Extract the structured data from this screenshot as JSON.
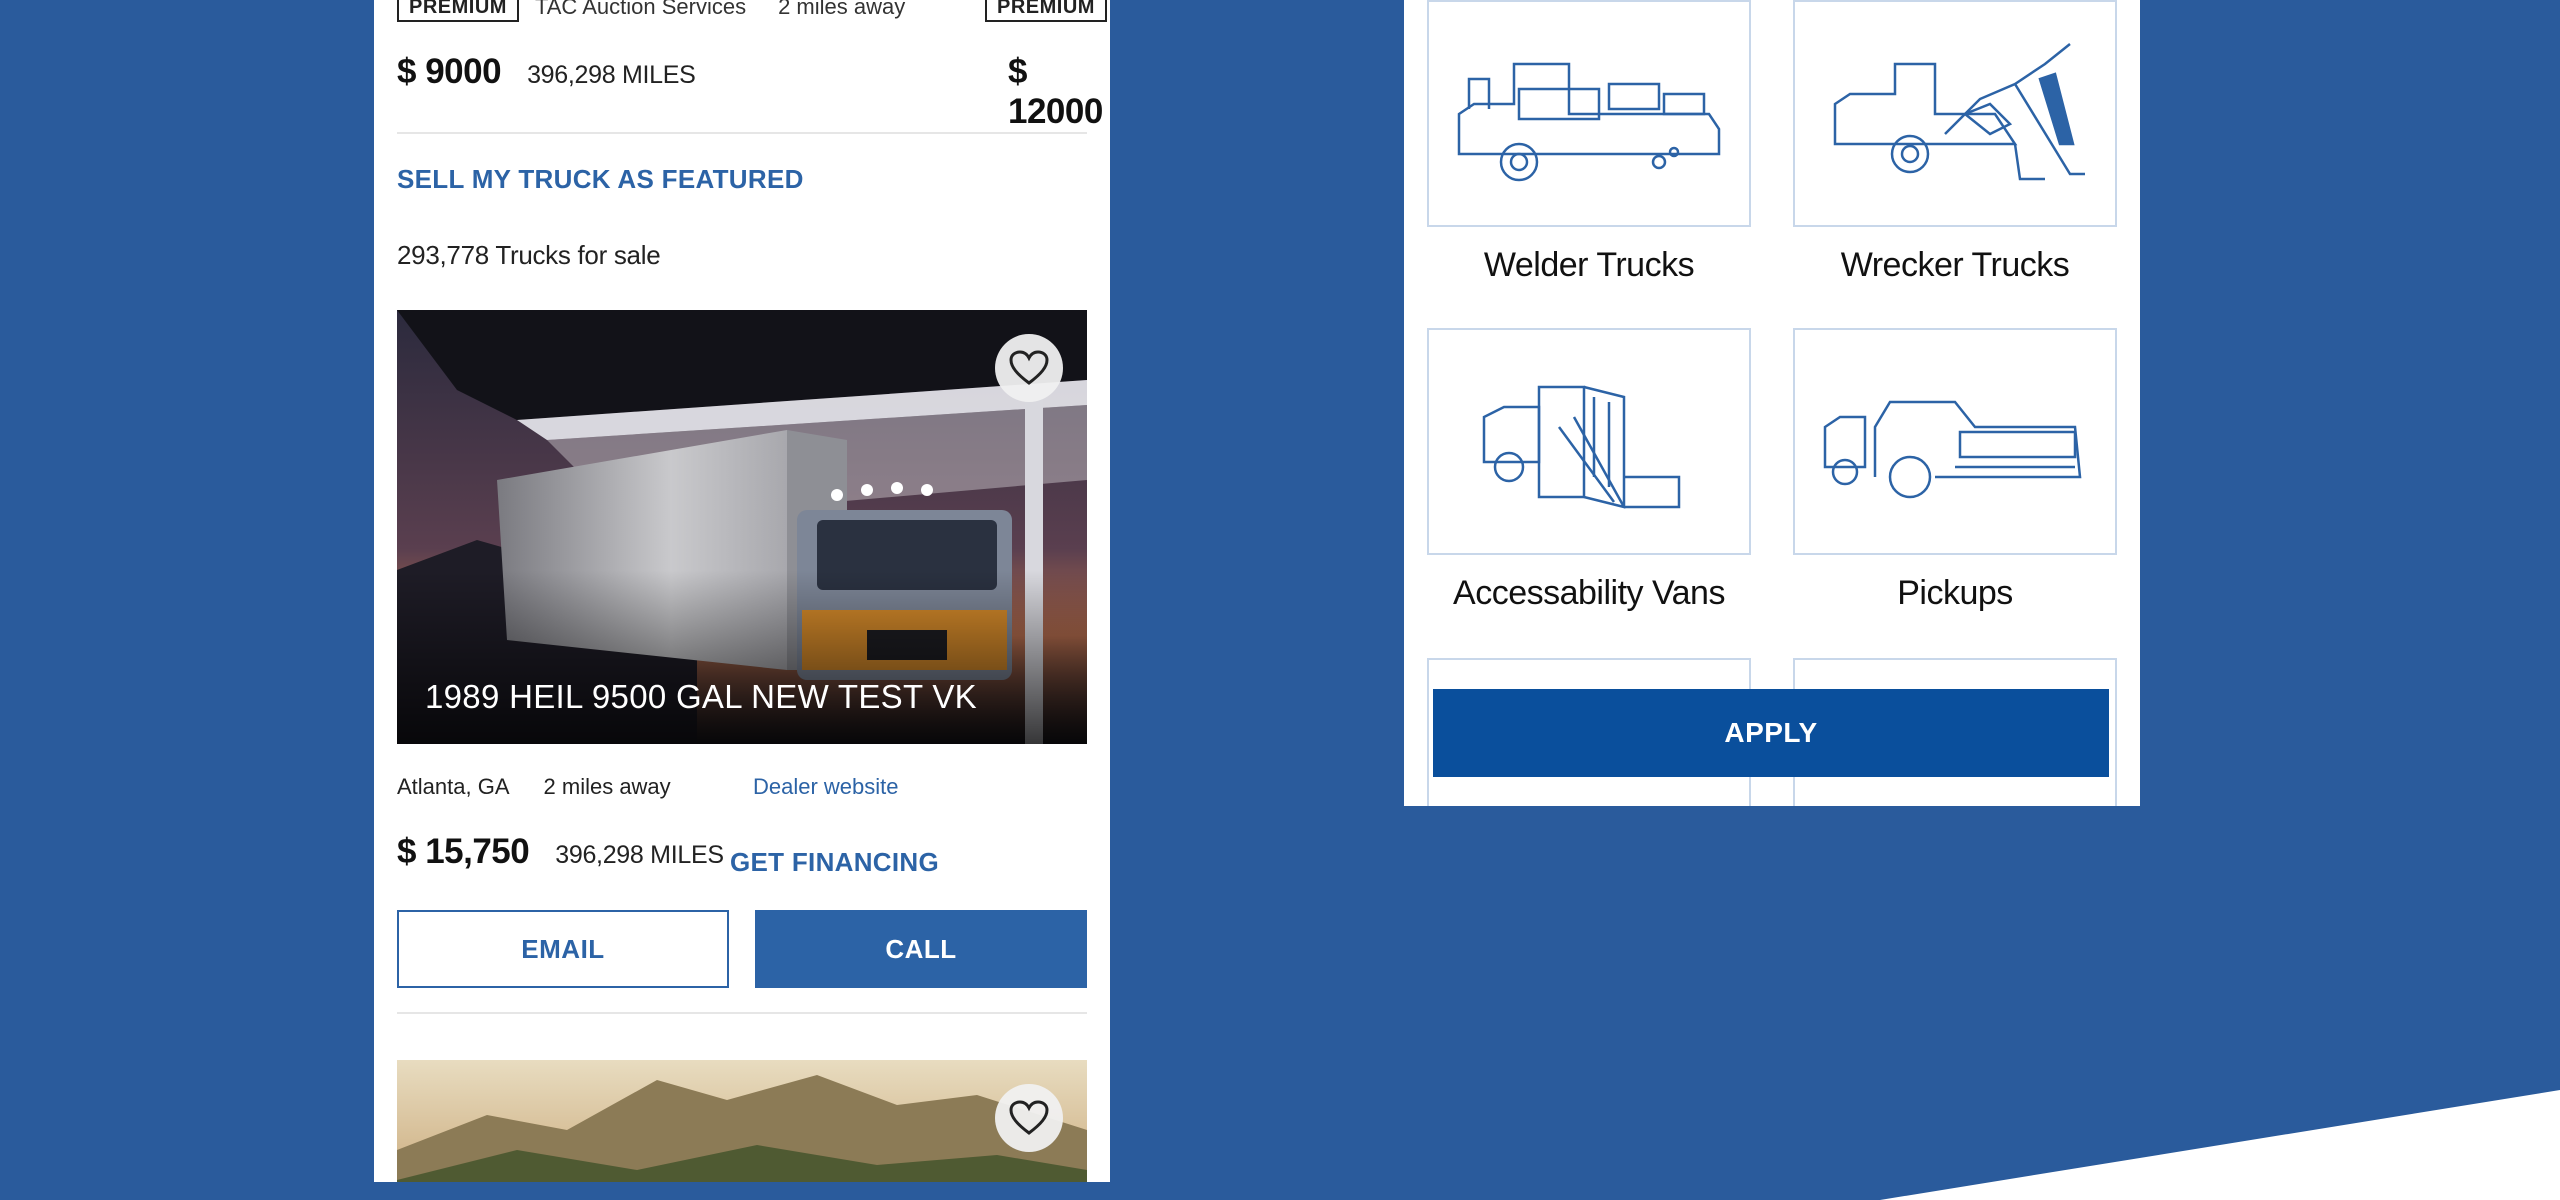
{
  "listing_prev": {
    "badge": "PREMIUM",
    "dealer": "TAC Auction Services",
    "distance": "2 miles away",
    "price": "$ 9000",
    "miles": "396,298 MILES",
    "next_badge": "PREMIUM",
    "next_price": "$ 12000"
  },
  "sell_link": "SELL MY TRUCK AS FEATURED",
  "results_count": "293,778 Trucks for sale",
  "listing": {
    "title": "1989 HEIL 9500 GAL NEW TEST VK",
    "location": "Atlanta, GA",
    "distance": "2 miles away",
    "dealer_link": "Dealer website",
    "price": "$ 15,750",
    "miles": "396,298 MILES",
    "financing_link": "GET FINANCING",
    "email_label": "EMAIL",
    "call_label": "CALL",
    "favorite_icon": "heart-icon"
  },
  "categories": [
    {
      "label": "Welder Trucks",
      "icon": "welder-truck-icon"
    },
    {
      "label": "Wrecker Trucks",
      "icon": "wrecker-truck-icon"
    },
    {
      "label": "Accessability Vans",
      "icon": "accessibility-van-icon"
    },
    {
      "label": "Pickups",
      "icon": "pickup-truck-icon"
    }
  ],
  "apply_label": "APPLY",
  "colors": {
    "background": "#2a5b9c",
    "accent": "#2c63a6",
    "apply": "#0a4f9c",
    "tile_border": "#c8d7ea"
  }
}
